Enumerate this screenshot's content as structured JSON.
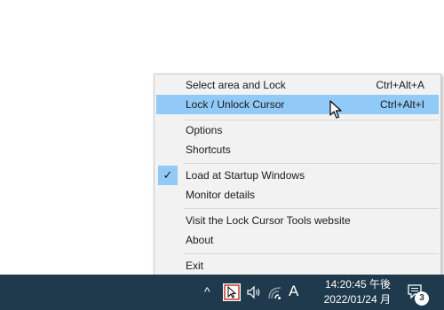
{
  "menu": {
    "items": [
      {
        "label": "Select area and Lock",
        "accel": "Ctrl+Alt+A"
      },
      {
        "label": "Lock / Unlock Cursor",
        "accel": "Ctrl+Alt+I"
      },
      {
        "label": "Options",
        "accel": ""
      },
      {
        "label": "Shortcuts",
        "accel": ""
      },
      {
        "label": "Load at Startup Windows",
        "accel": "",
        "checked": true
      },
      {
        "label": "Monitor details",
        "accel": ""
      },
      {
        "label": "Visit the Lock Cursor Tools website",
        "accel": ""
      },
      {
        "label": "About",
        "accel": ""
      },
      {
        "label": "Exit",
        "accel": ""
      }
    ],
    "checkmark": "✓",
    "highlight_color": "#91c9f7"
  },
  "taskbar": {
    "chevron": "^",
    "ime": "A",
    "time": "14:20:45 午後",
    "date": "2022/01/24 月",
    "notification_count": "3",
    "background_color": "#1f3a4c"
  }
}
